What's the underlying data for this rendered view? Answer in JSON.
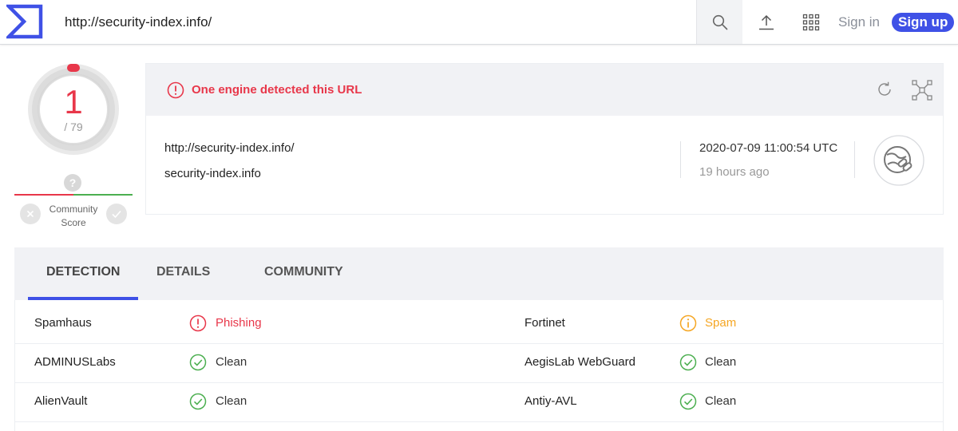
{
  "header": {
    "url_value": "http://security-index.info/",
    "signin_label": "Sign in",
    "signup_label": "Sign up",
    "icons": [
      "virustotal-logo",
      "search-icon",
      "upload-icon",
      "apps-grid-icon"
    ]
  },
  "score": {
    "detections": "1",
    "total": "/ 79",
    "community_label_1": "Community",
    "community_label_2": "Score",
    "community_unknown": "?"
  },
  "summary": {
    "alert": "One engine detected this URL",
    "url": "http://security-index.info/",
    "domain": "security-index.info",
    "scan_date": "2020-07-09 11:00:54 UTC",
    "scan_ago": "19 hours ago",
    "colors": {
      "alert": "#e8374a",
      "accent": "#3f51e6",
      "warning": "#f5a623",
      "clean": "#4caf50"
    }
  },
  "tabs": [
    {
      "label": "DETECTION",
      "active": true
    },
    {
      "label": "DETAILS",
      "active": false
    },
    {
      "label": "COMMUNITY",
      "active": false
    }
  ],
  "results": [
    {
      "left_engine": "Spamhaus",
      "left_result": "Phishing",
      "left_status": "malicious",
      "right_engine": "Fortinet",
      "right_result": "Spam",
      "right_status": "suspicious"
    },
    {
      "left_engine": "ADMINUSLabs",
      "left_result": "Clean",
      "left_status": "clean",
      "right_engine": "AegisLab WebGuard",
      "right_result": "Clean",
      "right_status": "clean"
    },
    {
      "left_engine": "AlienVault",
      "left_result": "Clean",
      "left_status": "clean",
      "right_engine": "Antiy-AVL",
      "right_result": "Clean",
      "right_status": "clean"
    }
  ]
}
